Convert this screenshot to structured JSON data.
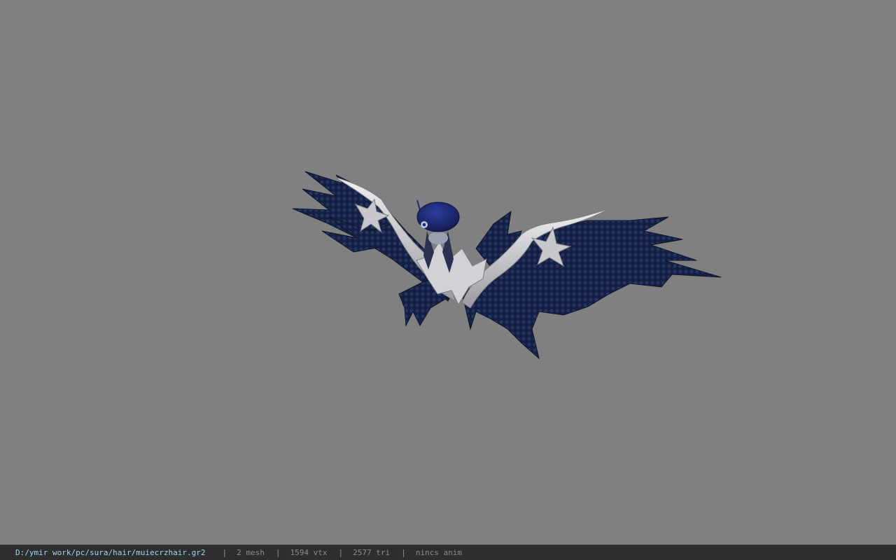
{
  "viewer": {
    "background_color": "#808080",
    "model_description_icon": "winged-hair-model-icon"
  },
  "status": {
    "file_path": "D:/ymir work/pc/sura/hair/muiecrzhair.gr2",
    "separator": "|",
    "mesh_count": "2 mesh",
    "vertex_count": "1594 vtx",
    "triangle_count": "2577 tri",
    "animation": "nincs anim"
  },
  "colors": {
    "wing_dark": "#121c36",
    "wing_mid": "#1f2f5e",
    "bone_white": "#d9d9dc",
    "cap_blue": "#1b2a78",
    "statusbar_bg": "#2e2e2e",
    "path_color": "#9fd6f0"
  }
}
